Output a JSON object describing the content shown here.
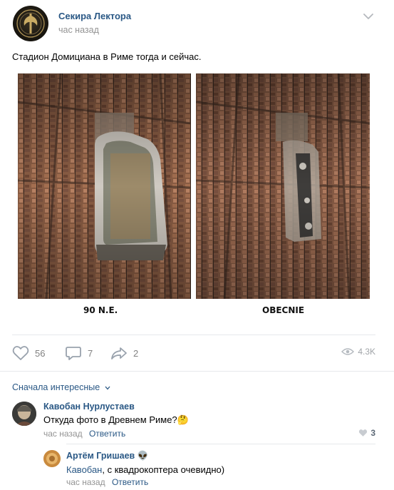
{
  "post": {
    "author": "Секира Лектора",
    "time": "час назад",
    "text": "Стадион Домициана в Риме тогда и сейчас.",
    "images": [
      {
        "caption": "90 N.E."
      },
      {
        "caption": "OBECNIE"
      }
    ]
  },
  "actions": {
    "likes": "56",
    "comments": "7",
    "shares": "2",
    "views": "4.3K"
  },
  "comments_sort": "Сначала интересные",
  "comments": [
    {
      "author": "Кавобан Нурлустаев",
      "text": "Откуда фото в Древнем Риме?",
      "emoji": "🤔",
      "time": "час назад",
      "reply_label": "Ответить",
      "likes": "3"
    },
    {
      "author": "Артём Гришаев",
      "author_emoji": "👽",
      "reply_to": "Кавобан",
      "text": ", с квадрокоптера очевидно)",
      "time": "час назад",
      "reply_label": "Ответить"
    }
  ],
  "colors": {
    "link": "#2a5885",
    "muted": "#939393",
    "divider": "#e7e8ec"
  }
}
